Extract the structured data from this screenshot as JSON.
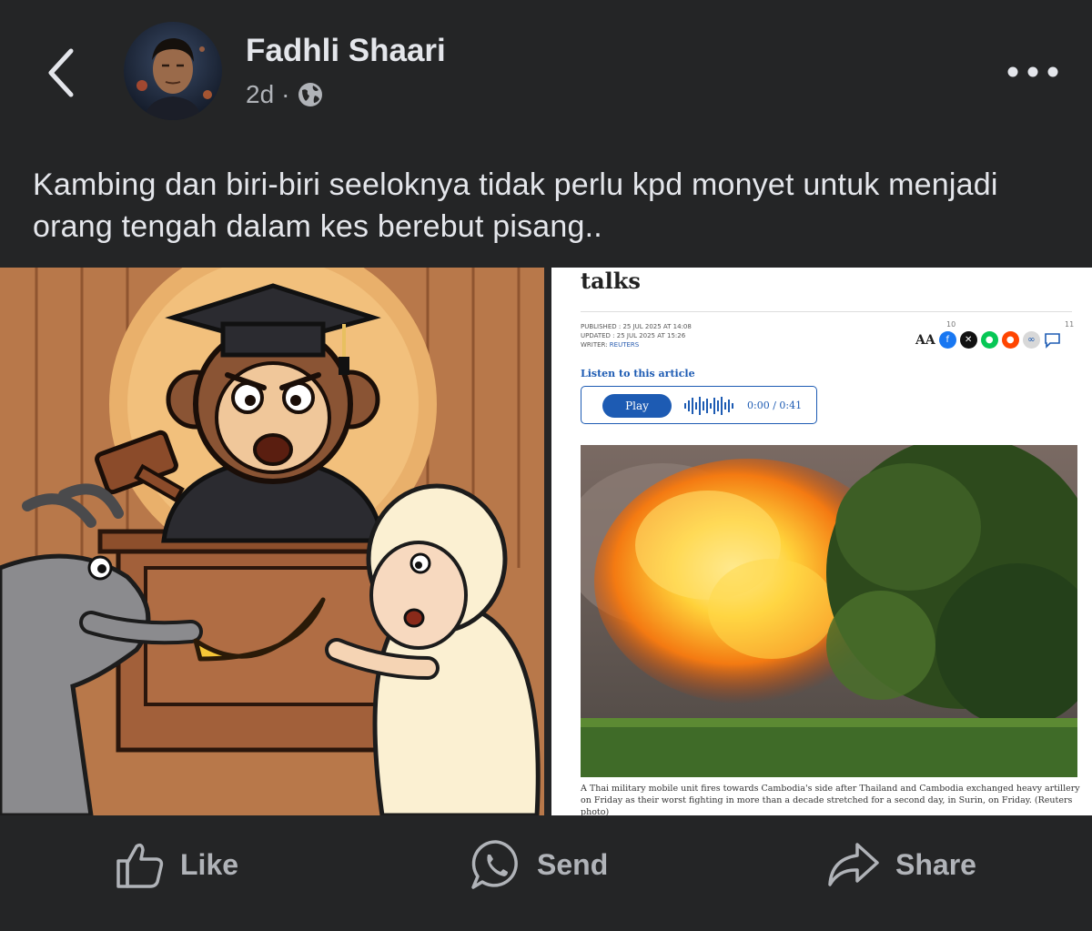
{
  "post": {
    "author": "Fadhli Shaari",
    "time": "2d",
    "separator": "·",
    "audience_icon": "globe-icon",
    "caption": "Kambing dan biri-biri seeloknya tidak perlu kpd monyet untuk menjadi orang tengah dalam kes berebut pisang.."
  },
  "article": {
    "title": "talks",
    "published": "PUBLISHED : 25 JUL 2025 AT 14:08",
    "updated": "UPDATED : 25 JUL 2025 AT 15:26",
    "writer_label": "WRITER:",
    "writer": "REUTERS",
    "share_count": "10",
    "comment_count": "11",
    "text_size_label": "AA",
    "listen_label": "Listen to this article",
    "play_label": "Play",
    "audio_time": "0:00 / 0:41",
    "photo_caption": "A Thai military mobile unit fires towards Cambodia's side after Thailand and Cambodia exchanged heavy artillery on Friday as their worst fighting in more than a decade stretched for a second day, in Surin, on Friday. (Reuters photo)"
  },
  "actions": {
    "like": "Like",
    "send": "Send",
    "share": "Share"
  },
  "colors": {
    "background": "#242526",
    "text_primary": "#e4e6eb",
    "text_secondary": "#b0b3b8",
    "article_link": "#1d5bb3"
  }
}
